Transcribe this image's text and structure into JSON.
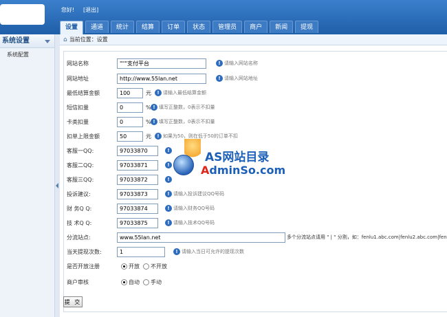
{
  "header": {
    "greeting": "您好!",
    "logout": "[退出]",
    "tabs": [
      "设置",
      "通道",
      "统计",
      "结算",
      "订单",
      "状态",
      "管理员",
      "商户",
      "新闻",
      "提现"
    ],
    "active_tab": "设置"
  },
  "sidebar": {
    "title": "系统设置",
    "items": [
      {
        "label": "系统配置"
      }
    ]
  },
  "breadcrumb": "当前位置：设置",
  "form": {
    "site_name": {
      "label": "网站名称",
      "value": "\"\"\"支付平台",
      "hint": "请输入网站名称"
    },
    "site_url": {
      "label": "网站地址",
      "value": "http://www.55lan.net",
      "hint": "请输入网站地址"
    },
    "min_settle": {
      "label": "最低结算金额",
      "value": "100",
      "unit": "元",
      "hint": "请输入最低结算金额"
    },
    "sms_deduct": {
      "label": "短信扣量",
      "value": "0",
      "unit": "%",
      "hint": "填写正整数，0表示不扣量"
    },
    "card_deduct": {
      "label": "卡类扣量",
      "value": "0",
      "unit": "%",
      "hint": "填写正整数，0表示不扣量"
    },
    "deduct_limit": {
      "label": "扣单上限金额",
      "value": "50",
      "unit": "元",
      "hint": "如果为50，则在低于50的订单不扣"
    },
    "qq1": {
      "label": "客服一QQ:",
      "value": "97033870"
    },
    "qq2": {
      "label": "客服二QQ:",
      "value": "97033871"
    },
    "qq3": {
      "label": "客服三QQ:",
      "value": "97033872"
    },
    "qq_suggest": {
      "label": "投诉建议:",
      "value": "97033873",
      "hint": "请输入投诉建议QQ号码"
    },
    "qq_finance": {
      "label": "财 务Q Q:",
      "value": "97033874",
      "hint": "请输入财务QQ号码"
    },
    "qq_tech": {
      "label": "技 术Q Q:",
      "value": "97033875",
      "hint": "请输入技术QQ号码"
    },
    "split_site": {
      "label": "分流站点:",
      "value": "www.55lan.net",
      "hint": "多个分流站点请用 \" | \" 分割，如：fenlu1.abc.com|fenlu2.abc.com|fenl"
    },
    "daily_withdraw": {
      "label": "当天提现次数:",
      "value": "1",
      "hint": "请输入当日可允许的提现次数"
    },
    "open_register": {
      "label": "是否开放注册",
      "options": [
        "开放",
        "不开放"
      ],
      "selected": "开放"
    },
    "merchant_review": {
      "label": "商户审核",
      "options": [
        "自动",
        "手动"
      ],
      "selected": "自动"
    },
    "submit_label": "提 交"
  },
  "watermark": {
    "line1": "AS网站目录",
    "line2_red": "A",
    "line2_blue": "dminSo.com"
  }
}
